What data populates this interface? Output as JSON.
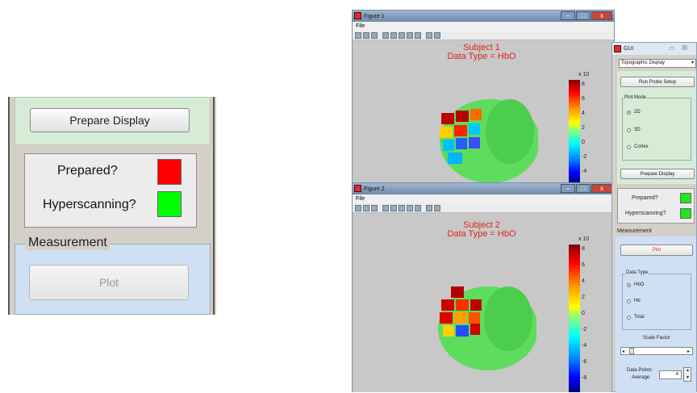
{
  "zoom": {
    "prepare_label": "Prepare Display",
    "prepared_label": "Prepared?",
    "hyperscanning_label": "Hyperscanning?",
    "measurement_label": "Measurement",
    "plot_label": "Plot",
    "prepared_color": "#ff0000",
    "hyperscanning_color": "#00ff00"
  },
  "figure1": {
    "title": "Figure 1",
    "menu": "File",
    "subject": "Subject 1",
    "data_type": "Data Type = HbO",
    "exponent": "x 10",
    "ticks": [
      "8",
      "6",
      "4",
      "2",
      "0",
      "-2",
      "-4"
    ]
  },
  "figure2": {
    "title": "Figure 2",
    "menu": "File",
    "subject": "Subject 2",
    "data_type": "Data Type = HbO",
    "exponent": "x 10",
    "ticks": [
      "8",
      "6",
      "4",
      "2",
      "0",
      "-2",
      "-4",
      "-6",
      "-8"
    ]
  },
  "gui": {
    "title": "GUI",
    "display_select": "Topographic Display",
    "run_probe": "Run Probe Setup",
    "plot_mode": "Plot Mode",
    "modes": [
      "2D",
      "3D",
      "Cortex"
    ],
    "prepare": "Prepare Display",
    "prepared": "Prepared?",
    "hyperscanning": "Hyperscanning?",
    "measurement": "Measurement",
    "plot": "Plot",
    "data_type": "Data Type",
    "types": [
      "HbO",
      "Hb",
      "Total"
    ],
    "scale_factor": "Scale Factor",
    "data_points": "Data Points",
    "average": "Average",
    "average_value": "4"
  }
}
